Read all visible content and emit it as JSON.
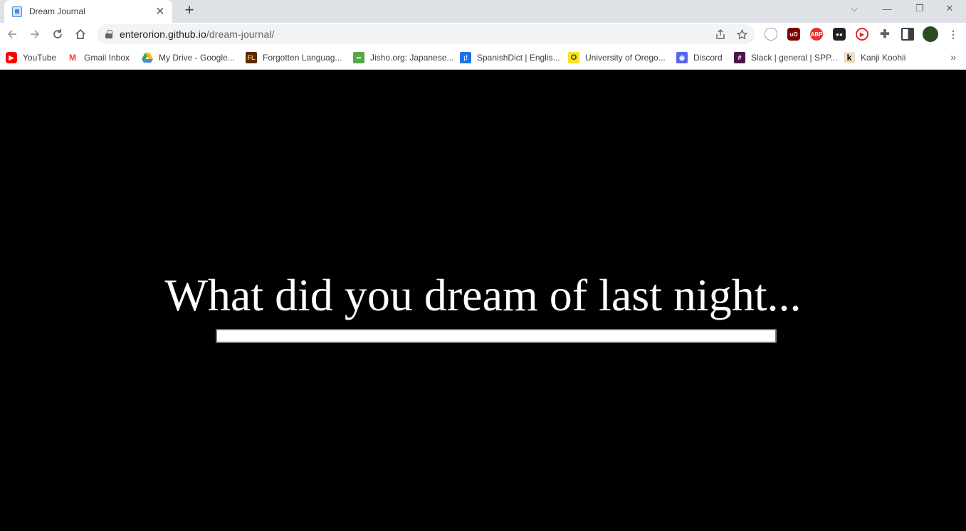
{
  "browser": {
    "tab": {
      "title": "Dream Journal",
      "close_glyph": "✕"
    },
    "new_tab_glyph": "+",
    "window_controls": {
      "dropdown": "⌵",
      "minimize": "—",
      "restore": "❐",
      "close": "✕"
    },
    "url": {
      "host": "enterorion.github.io",
      "path": "/dream-journal/"
    },
    "bookmarks": [
      {
        "label": "YouTube",
        "icon": "youtube-icon",
        "color": "#ff0000"
      },
      {
        "label": "Gmail Inbox",
        "icon": "gmail-icon",
        "color": "#ea4335"
      },
      {
        "label": "My Drive - Google...",
        "icon": "google-drive-icon",
        "color": "#34a853"
      },
      {
        "label": "Forgotten Languag...",
        "icon": "forgotten-languages-icon",
        "color": "#5a2a00"
      },
      {
        "label": "Jisho.org: Japanese...",
        "icon": "jisho-icon",
        "color": "#56a846"
      },
      {
        "label": "SpanishDict | Englis...",
        "icon": "spanishdict-icon",
        "color": "#1a73e8"
      },
      {
        "label": "University of Orego...",
        "icon": "uoregon-icon",
        "color": "#fce122"
      },
      {
        "label": "Discord",
        "icon": "discord-icon",
        "color": "#5865f2"
      },
      {
        "label": "Slack | general | SPP...",
        "icon": "slack-icon",
        "color": "#4a154b"
      },
      {
        "label": "Kanji Koohii",
        "icon": "kanji-koohii-icon",
        "color": "#f0e0c8"
      }
    ],
    "bookmarks_more": "»"
  },
  "page": {
    "prompt": "What did you dream of last night...",
    "input_value": "",
    "background_color": "#000000",
    "text_color": "#ffffff"
  }
}
